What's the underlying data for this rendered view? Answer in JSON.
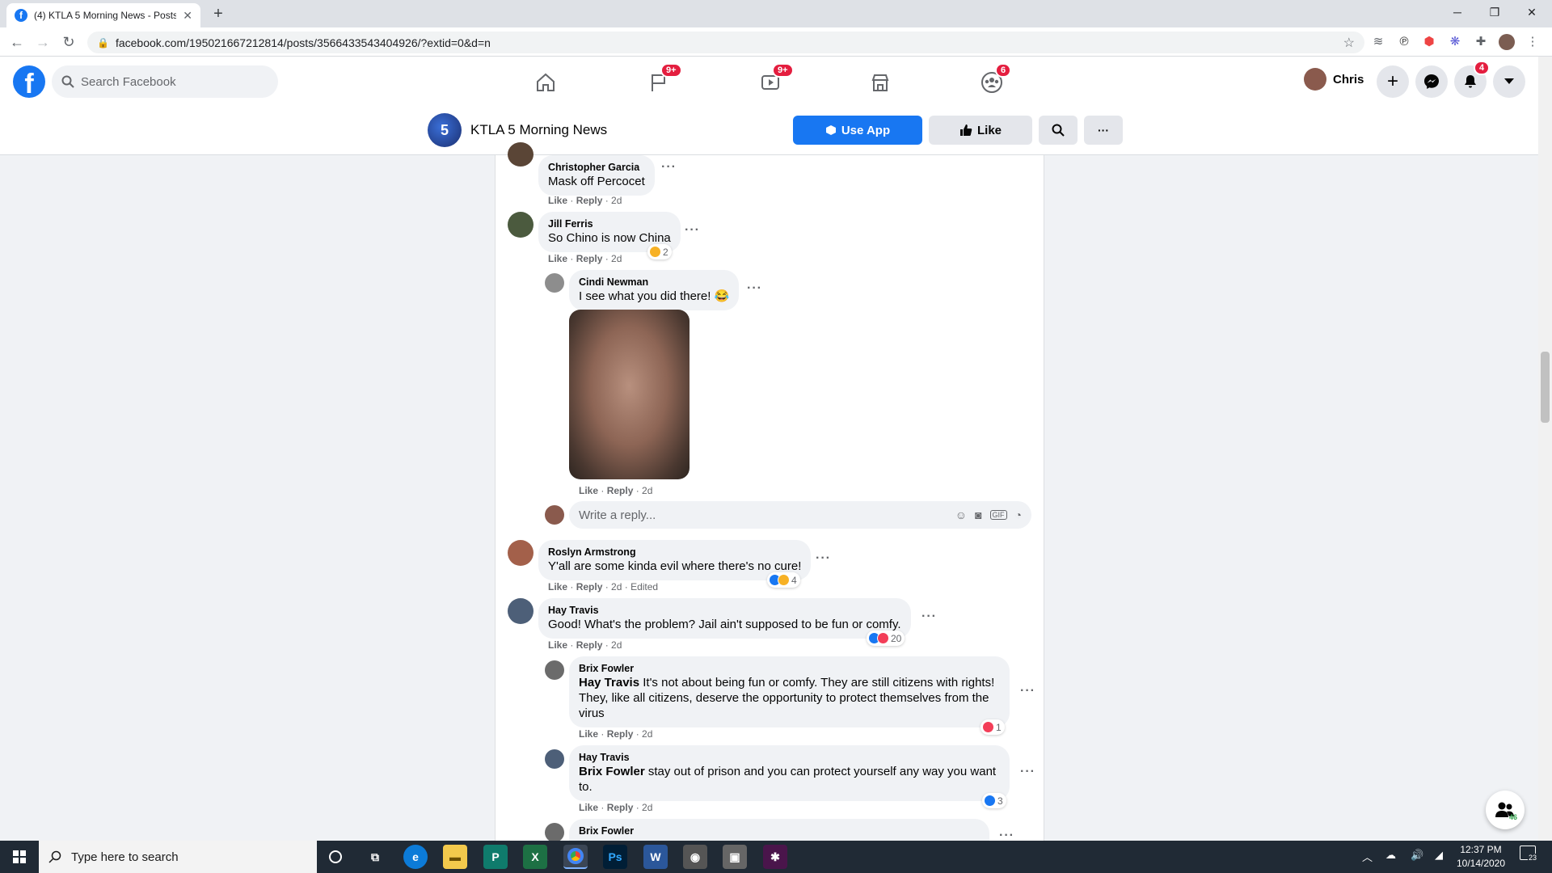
{
  "browser": {
    "tab_title": "(4) KTLA 5 Morning News - Posts",
    "url": "facebook.com/195021667212814/posts/3566433543404926/?extid=0&d=n"
  },
  "fb": {
    "search_placeholder": "Search Facebook",
    "nav_badges": {
      "pages": "9+",
      "watch": "9+",
      "groups": "6"
    },
    "user_name": "Chris",
    "notif_badge": "4"
  },
  "page": {
    "logo_text": "5",
    "name": "KTLA 5 Morning News",
    "use_app": "Use App",
    "like": "Like"
  },
  "labels": {
    "like": "Like",
    "reply": "Reply",
    "sep": " · "
  },
  "comments": [
    {
      "name": "Christopher Garcia",
      "text": "Mask off Percocet",
      "time": "2d"
    },
    {
      "name": "Jill Ferris",
      "text": "So Chino is now China",
      "time": "2d",
      "reactions": "2"
    },
    {
      "name": "Cindi Newman",
      "text": "I see what you did there! 😂",
      "time": "2d"
    },
    {
      "name": "Roslyn Armstrong",
      "text": "Y'all are some kinda evil where there's no cure!",
      "time": "2d",
      "edited": "Edited",
      "reactions": "4"
    },
    {
      "name": "Hay Travis",
      "text": "Good! What's the problem? Jail ain't supposed to be fun or comfy.",
      "time": "2d",
      "reactions": "20"
    },
    {
      "name": "Brix Fowler",
      "mention": "Hay Travis",
      "text": "It's not about being fun or comfy. They are still citizens with rights! They, like all citizens, deserve the opportunity to protect themselves from the virus",
      "time": "2d",
      "reactions": "1"
    },
    {
      "name": "Hay Travis",
      "mention": "Brix Fowler",
      "text": "stay out of prison and you can protect yourself any way you want to.",
      "time": "2d",
      "reactions": "3"
    },
    {
      "name": "Brix Fowler"
    }
  ],
  "reply_placeholder": "Write a reply...",
  "chat_count": "46",
  "taskbar": {
    "search_placeholder": "Type here to search",
    "time": "12:37 PM",
    "date": "10/14/2020",
    "notif_count": "23"
  }
}
